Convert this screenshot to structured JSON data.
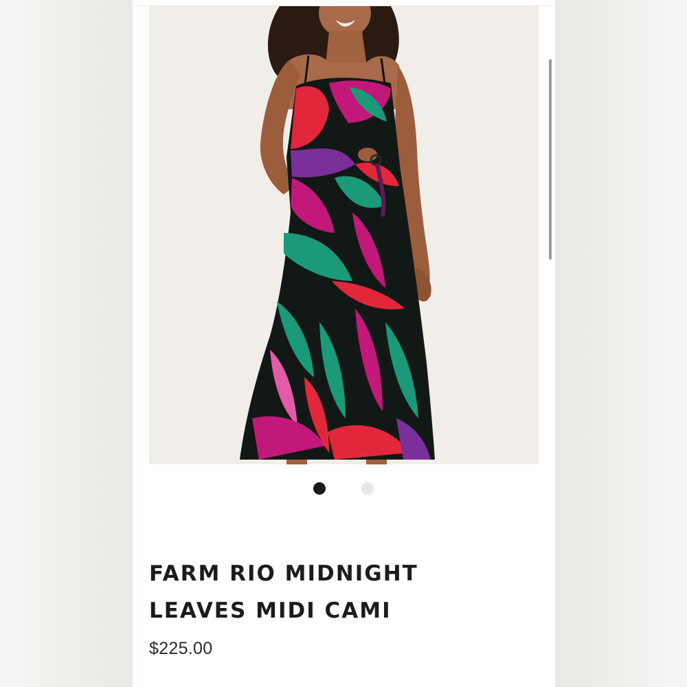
{
  "product": {
    "image_alt": "Woman wearing a tropical leaf print midi cami dress",
    "carousel": {
      "total": 2,
      "active_index": 1
    },
    "title_line1": "FARM RIO MIDNIGHT",
    "title_line2": "LEAVES MIDI CAMI",
    "price": "$225.00"
  },
  "colors": {
    "backdrop": "#f0ebe6",
    "dot_active": "#1a1a1a",
    "dot_inactive": "#e7e7e7",
    "leaf_green": "#1a9a78",
    "leaf_magenta": "#c2187a",
    "leaf_red": "#e3273b",
    "leaf_purple": "#7b2f9a",
    "dress_base": "#121816"
  }
}
